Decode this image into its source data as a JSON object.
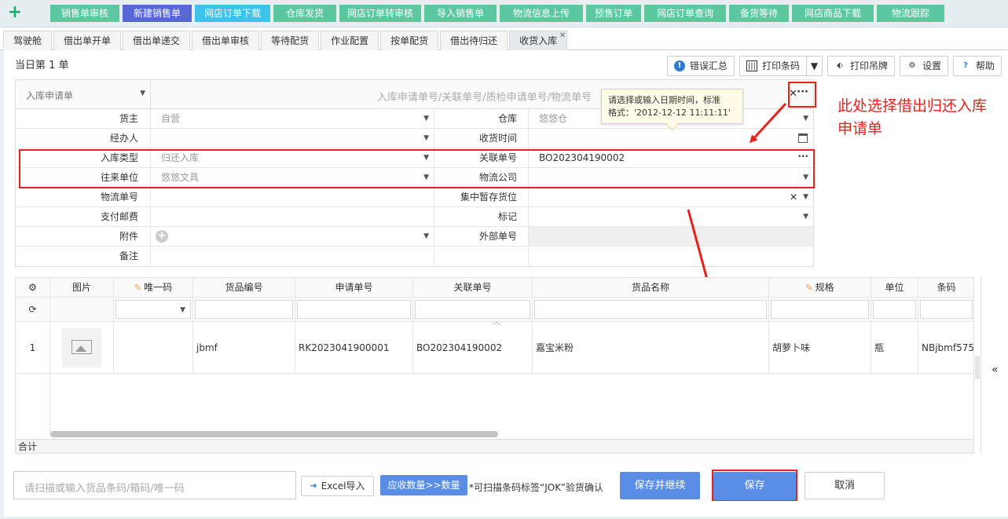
{
  "top_nav": {
    "tabs": [
      {
        "label": "销售单审核",
        "color": "#5cc8a0"
      },
      {
        "label": "新建销售单",
        "color": "#5867d8"
      },
      {
        "label": "网店订单下载",
        "color": "#3cc3ea"
      },
      {
        "label": "仓库发货",
        "color": "#5cc8a0"
      },
      {
        "label": "网店订单转审核",
        "color": "#5cc8a0"
      },
      {
        "label": "导入销售单",
        "color": "#5cc8a0"
      },
      {
        "label": "物流信息上传",
        "color": "#5cc8a0"
      },
      {
        "label": "预售订单",
        "color": "#5cc8a0"
      },
      {
        "label": "网店订单查询",
        "color": "#5cc8a0"
      },
      {
        "label": "备货等待",
        "color": "#5cc8a0"
      },
      {
        "label": "网店商品下载",
        "color": "#5cc8a0"
      },
      {
        "label": "物流跟踪",
        "color": "#5cc8a0"
      }
    ]
  },
  "sub_tabs": [
    {
      "label": "驾驶舱"
    },
    {
      "label": "借出单开单"
    },
    {
      "label": "借出单递交"
    },
    {
      "label": "借出单审核"
    },
    {
      "label": "等待配货"
    },
    {
      "label": "作业配置"
    },
    {
      "label": "按单配货"
    },
    {
      "label": "借出待归还"
    },
    {
      "label": "收货入库",
      "active": true
    }
  ],
  "day_count": "当日第 1 单",
  "toolbar": {
    "error_summary": "错误汇总",
    "print_barcode": "打印条码",
    "print_tag": "打印吊牌",
    "settings": "设置",
    "help": "帮助"
  },
  "form": {
    "request_select": "入库申请单",
    "search_placeholder": "入库申请单号/关联单号/质检申请单号/物流单号",
    "rows": [
      {
        "l1": "货主",
        "v1": "自营",
        "l2": "仓库",
        "v2": "悠悠仓"
      },
      {
        "l1": "经办人",
        "v1": "",
        "l2": "收货时间",
        "v2": ""
      },
      {
        "l1": "入库类型",
        "v1": "归还入库",
        "l2": "关联单号",
        "v2": "BO202304190002"
      },
      {
        "l1": "往来单位",
        "v1": "悠悠文具",
        "l2": "物流公司",
        "v2": ""
      },
      {
        "l1": "物流单号",
        "v1": "",
        "l2": "集中暂存货位",
        "v2": ""
      },
      {
        "l1": "支付邮费",
        "v1": "",
        "l2": "标记",
        "v2": ""
      },
      {
        "l1": "附件",
        "v1": "",
        "l2": "外部单号",
        "v2": ""
      },
      {
        "l1": "备注",
        "v1": "",
        "l2": "",
        "v2": ""
      }
    ]
  },
  "tooltip": {
    "line1": "请选择或输入日期时间，标准",
    "line2": "格式：'2012-12-12 11:11:11'"
  },
  "annotation": "此处选择借出归还入库申请单",
  "grid": {
    "columns": [
      "图片",
      "唯一码",
      "货品编号",
      "申请单号",
      "关联单号",
      "货品名称",
      "规格",
      "单位",
      "条码"
    ],
    "rows": [
      {
        "no": "1",
        "unique": "",
        "code": "jbmf",
        "request": "RK2023041900001",
        "related": "BO202304190002",
        "name": "嘉宝米粉",
        "spec": "胡萝卜味",
        "unit": "瓶",
        "barcode": "NBjbmf575"
      }
    ],
    "total_label": "合计"
  },
  "bottom": {
    "scan_placeholder": "请扫描或输入货品条码/箱码/唯一码",
    "excel_import": "Excel导入",
    "qty_button": "应收数量>>数量",
    "hint": "*可扫描条码标签“JOK”验货确认",
    "save_continue": "保存并继续",
    "save": "保存",
    "cancel": "取消"
  }
}
